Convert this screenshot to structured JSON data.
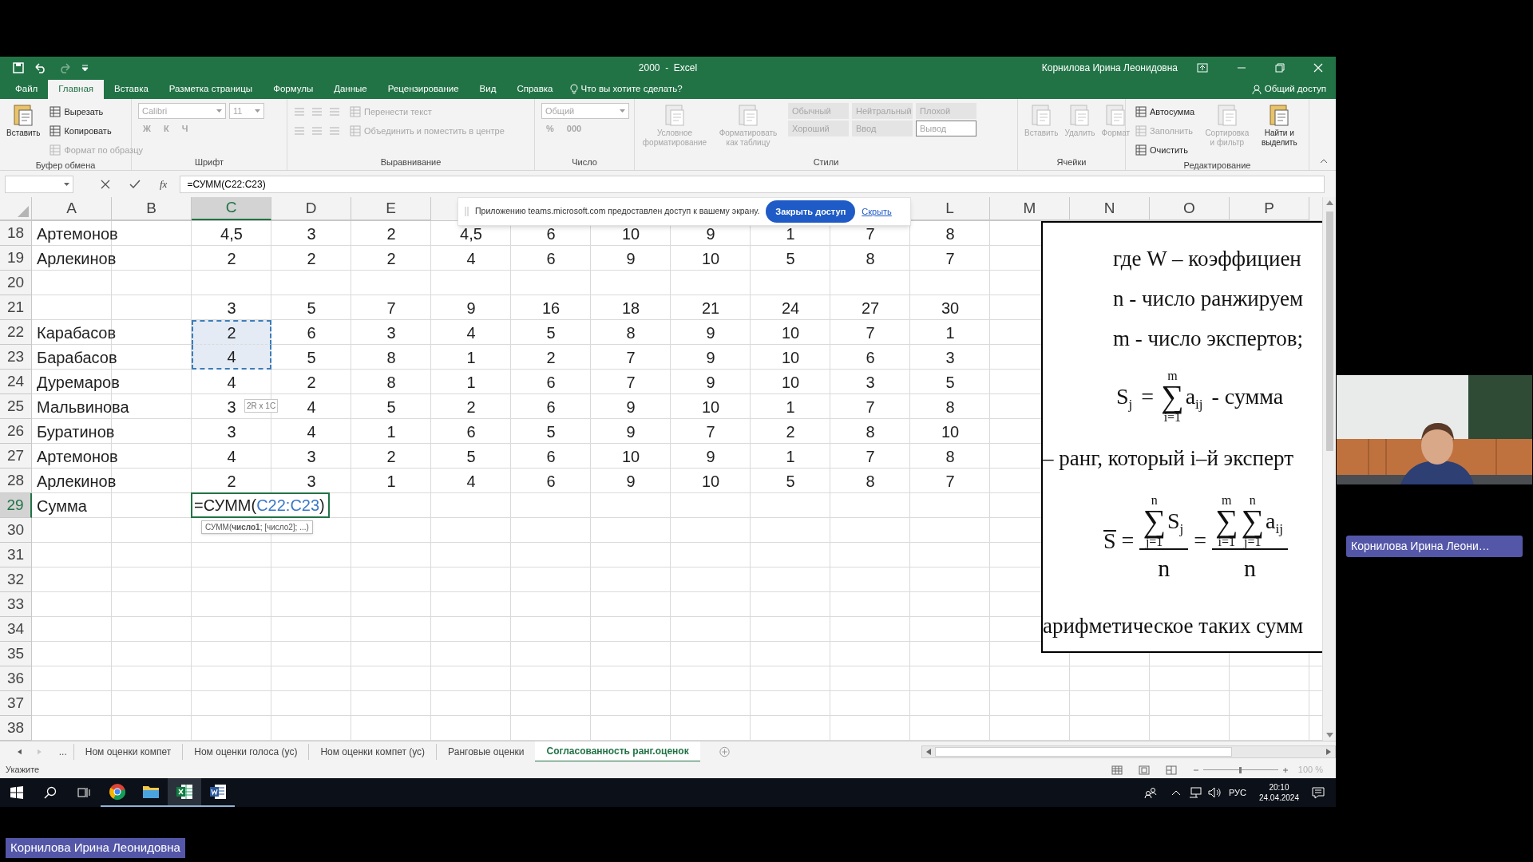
{
  "title_bar": {
    "document": "2000  -  Excel",
    "user": "Корнилова Ирина Леонидовна"
  },
  "ribbon_tabs": [
    {
      "label": "Файл",
      "selected": false
    },
    {
      "label": "Главная",
      "selected": true
    },
    {
      "label": "Вставка",
      "selected": false
    },
    {
      "label": "Разметка страницы",
      "selected": false
    },
    {
      "label": "Формулы",
      "selected": false
    },
    {
      "label": "Данные",
      "selected": false
    },
    {
      "label": "Рецензирование",
      "selected": false
    },
    {
      "label": "Вид",
      "selected": false
    },
    {
      "label": "Справка",
      "selected": false
    }
  ],
  "tell_me": "Что вы хотите сделать?",
  "share": "Общий доступ",
  "ribbon": [
    {
      "label": "Буфер обмена",
      "parts": [
        {
          "kind": "big",
          "label": "Вставить",
          "disabled": false
        },
        {
          "kind": "stack",
          "rows": [
            [
              {
                "kind": "small",
                "label": "Вырезать",
                "disabled": false
              }
            ],
            [
              {
                "kind": "small",
                "label": "Копировать",
                "disabled": false
              }
            ],
            [
              {
                "kind": "small",
                "label": "Формат по образцу",
                "disabled": true
              }
            ]
          ]
        }
      ]
    },
    {
      "label": "Шрифт",
      "parts": [
        {
          "kind": "stack",
          "rows": [
            [
              {
                "kind": "field",
                "value": "Calibri",
                "disabled": true
              },
              {
                "kind": "field",
                "value": "11",
                "disabled": true
              }
            ],
            [
              {
                "kind": "glyph",
                "text": "Ж",
                "disabled": true
              },
              {
                "kind": "glyph",
                "text": "К",
                "disabled": true
              },
              {
                "kind": "glyph",
                "text": "Ч",
                "disabled": true
              }
            ]
          ]
        }
      ]
    },
    {
      "label": "Выравнивание",
      "parts": [
        {
          "kind": "stack",
          "rows": [
            [
              {
                "kind": "iconbar"
              }
            ],
            [
              {
                "kind": "iconbar"
              }
            ]
          ]
        },
        {
          "kind": "stack",
          "rows": [
            [
              {
                "kind": "small",
                "label": "Перенести текст",
                "disabled": true
              }
            ],
            [
              {
                "kind": "small",
                "label": "Объединить и поместить в центре",
                "disabled": true
              }
            ]
          ]
        }
      ]
    },
    {
      "label": "Число",
      "parts": [
        {
          "kind": "stack",
          "rows": [
            [
              {
                "kind": "field",
                "value": "Общий",
                "disabled": true
              }
            ],
            [
              {
                "kind": "glyph",
                "text": "%",
                "disabled": true
              },
              {
                "kind": "glyph",
                "text": "000",
                "disabled": true
              }
            ]
          ]
        }
      ]
    },
    {
      "label": "Стили",
      "parts": [
        {
          "kind": "big",
          "label": "Условное форматирование",
          "disabled": true
        },
        {
          "kind": "big",
          "label": "Форматировать как таблицу",
          "disabled": true
        },
        {
          "kind": "stack",
          "rows": [
            [
              {
                "kind": "style",
                "label": "Обычный",
                "outlined": false,
                "disabled": true
              },
              {
                "kind": "style",
                "label": "Нейтральный",
                "outlined": false,
                "disabled": true
              },
              {
                "kind": "style",
                "label": "Плохой",
                "outlined": false,
                "disabled": true
              }
            ],
            [
              {
                "kind": "style",
                "label": "Хороший",
                "outlined": false,
                "disabled": true
              },
              {
                "kind": "style",
                "label": "Ввод",
                "outlined": false,
                "disabled": true
              },
              {
                "kind": "style",
                "label": "Вывод",
                "outlined": true,
                "disabled": true
              }
            ]
          ]
        }
      ]
    },
    {
      "label": "Ячейки",
      "parts": [
        {
          "kind": "big",
          "label": "Вставить",
          "disabled": true
        },
        {
          "kind": "big",
          "label": "Удалить",
          "disabled": true
        },
        {
          "kind": "big",
          "label": "Формат",
          "disabled": true
        }
      ]
    },
    {
      "label": "Редактирование",
      "parts": [
        {
          "kind": "stack",
          "rows": [
            [
              {
                "kind": "small",
                "label": "Автосумма",
                "disabled": false
              }
            ],
            [
              {
                "kind": "small",
                "label": "Заполнить",
                "disabled": true
              }
            ],
            [
              {
                "kind": "small",
                "label": "Очистить",
                "disabled": false
              }
            ]
          ]
        },
        {
          "kind": "big",
          "label": "Сортировка и фильтр",
          "disabled": true
        },
        {
          "kind": "big",
          "label": "Найти и выделить",
          "disabled": false
        }
      ]
    }
  ],
  "formula_bar": {
    "function_button": "fx",
    "formula": "=СУММ(C22:C23)"
  },
  "column_headers": [
    {
      "label": "A",
      "selected": false
    },
    {
      "label": "B",
      "selected": false
    },
    {
      "label": "C",
      "selected": true
    },
    {
      "label": "D",
      "selected": false
    },
    {
      "label": "E",
      "selected": false
    },
    {
      "label": "L",
      "selected": false
    },
    {
      "label": "M",
      "selected": false
    },
    {
      "label": "N",
      "selected": false
    },
    {
      "label": "O",
      "selected": false
    },
    {
      "label": "P",
      "selected": false
    }
  ],
  "rows": [
    {
      "number": "18",
      "selected": false,
      "name": "Артемонов",
      "values": [
        "4,5",
        "3",
        "2",
        "4,5",
        "6",
        "10",
        "9",
        "1",
        "7",
        "8"
      ]
    },
    {
      "number": "19",
      "selected": false,
      "name": "Арлекинов",
      "values": [
        "2",
        "2",
        "2",
        "4",
        "6",
        "9",
        "10",
        "5",
        "8",
        "7"
      ]
    },
    {
      "number": "20",
      "selected": false
    },
    {
      "number": "21",
      "selected": false,
      "values": [
        "3",
        "5",
        "7",
        "9",
        "16",
        "18",
        "21",
        "24",
        "27",
        "30"
      ]
    },
    {
      "number": "22",
      "selected": false,
      "in_reference": true,
      "name": "Карабасов",
      "values": [
        "2",
        "6",
        "3",
        "4",
        "5",
        "8",
        "9",
        "10",
        "7",
        "1"
      ]
    },
    {
      "number": "23",
      "selected": false,
      "in_reference": true,
      "name": "Барабасов",
      "values": [
        "4",
        "5",
        "8",
        "1",
        "2",
        "7",
        "9",
        "10",
        "6",
        "3"
      ]
    },
    {
      "number": "24",
      "selected": false,
      "name": "Дуремаров",
      "values": [
        "4",
        "2",
        "8",
        "1",
        "6",
        "7",
        "9",
        "10",
        "3",
        "5"
      ]
    },
    {
      "number": "25",
      "selected": false,
      "name": "Мальвинова",
      "values": [
        "3",
        "4",
        "5",
        "2",
        "6",
        "9",
        "10",
        "1",
        "7",
        "8"
      ]
    },
    {
      "number": "26",
      "selected": false,
      "name": "Буратинов",
      "values": [
        "3",
        "4",
        "1",
        "6",
        "5",
        "9",
        "7",
        "2",
        "8",
        "10"
      ]
    },
    {
      "number": "27",
      "selected": false,
      "name": "Артемонов",
      "values": [
        "4",
        "3",
        "2",
        "5",
        "6",
        "10",
        "9",
        "1",
        "7",
        "8"
      ]
    },
    {
      "number": "28",
      "selected": false,
      "name": "Арлекинов",
      "values": [
        "2",
        "3",
        "1",
        "4",
        "6",
        "9",
        "10",
        "5",
        "8",
        "7"
      ]
    },
    {
      "number": "29",
      "selected": true,
      "name": "Сумма",
      "editing": {
        "parts": [
          {
            "kind": "plain",
            "text": "=СУММ("
          },
          {
            "kind": "reference",
            "text": "C22:C23"
          },
          {
            "kind": "plain",
            "text": ")"
          }
        ],
        "hint": "СУММ(**число1**; [число2]; ...)"
      }
    },
    {
      "number": "30",
      "selected": false
    },
    {
      "number": "31",
      "selected": false
    },
    {
      "number": "32",
      "selected": false
    },
    {
      "number": "33",
      "selected": false
    },
    {
      "number": "34",
      "selected": false
    },
    {
      "number": "35",
      "selected": false
    },
    {
      "number": "36",
      "selected": false
    },
    {
      "number": "37",
      "selected": false
    },
    {
      "number": "38",
      "selected": false
    }
  ],
  "range_tip": "2R x 1C",
  "share_notice": {
    "text": "Приложению teams.microsoft.com предоставлен доступ к вашему экрану.",
    "button": "Закрыть доступ",
    "link": "Скрыть"
  },
  "embedded_document": {
    "lines": [
      {
        "kind": "indented_text",
        "text": "где W – коэффициен"
      },
      {
        "kind": "indented_text",
        "text": "n - число ранжируем"
      },
      {
        "kind": "indented_text",
        "text": "m - число экспертов;"
      },
      {
        "kind": "formula",
        "tokens": [
          {
            "kind": "text",
            "text": "S"
          },
          {
            "kind": "sub",
            "text": "j"
          },
          {
            "kind": "text",
            "text": " = "
          },
          {
            "kind": "sum",
            "sign": "∑",
            "top": "m",
            "bottom": "i=1"
          },
          {
            "kind": "text",
            "text": "a"
          },
          {
            "kind": "sub",
            "text": "ij"
          },
          {
            "kind": "text",
            "text": " - сумма"
          }
        ]
      },
      {
        "kind": "text",
        "text": "– ранг, который i–й эксперт"
      },
      {
        "kind": "formula",
        "tokens": [
          {
            "kind": "overline",
            "text": "S"
          },
          {
            "kind": "text",
            "text": " = "
          },
          {
            "kind": "frac",
            "num": [
              {
                "kind": "sum",
                "sign": "∑",
                "top": "n",
                "bottom": "j=1"
              },
              {
                "kind": "text",
                "text": "S"
              },
              {
                "kind": "sub",
                "text": "j"
              }
            ],
            "den": [
              {
                "kind": "text",
                "text": "n"
              }
            ]
          },
          {
            "kind": "text",
            "text": " = "
          },
          {
            "kind": "frac",
            "num": [
              {
                "kind": "sum",
                "sign": "∑",
                "top": "m",
                "bottom": "i=1"
              },
              {
                "kind": "sum",
                "sign": "∑",
                "top": "n",
                "bottom": "j=1"
              },
              {
                "kind": "text",
                "text": "a"
              },
              {
                "kind": "sub",
                "text": "ij"
              }
            ],
            "den": [
              {
                "kind": "text",
                "text": "n"
              }
            ]
          }
        ]
      },
      {
        "kind": "text",
        "text": "арифметическое таких сумм"
      }
    ]
  },
  "sheet_tabs": [
    {
      "label": "Ном оценки компет",
      "selected": false
    },
    {
      "label": "Ном оценки голоса (ус)",
      "selected": false
    },
    {
      "label": "Ном оценки компет (ус)",
      "selected": false
    },
    {
      "label": "Ранговые оценки",
      "selected": false
    },
    {
      "label": "Согласованность ранг.оценок",
      "selected": true
    }
  ],
  "sheet_overflow": "...",
  "status_bar": {
    "mode": "Укажите",
    "zoom": "100 %",
    "zoom_slider": {
      "level": 0.5
    }
  },
  "taskbar": {
    "apps": [
      {
        "kind": "browser",
        "active": false
      },
      {
        "kind": "folder",
        "active": false
      },
      {
        "kind": "spreadsheet",
        "active": true
      },
      {
        "kind": "document",
        "active": false
      }
    ],
    "language": "РУС",
    "time": "20:10",
    "date": "24.04.2024"
  },
  "video_tile": {
    "kind": "picture",
    "name_tag": "Корнилова Ирина Леони…"
  },
  "presenter_tag": "Корнилова Ирина Леонидовна"
}
